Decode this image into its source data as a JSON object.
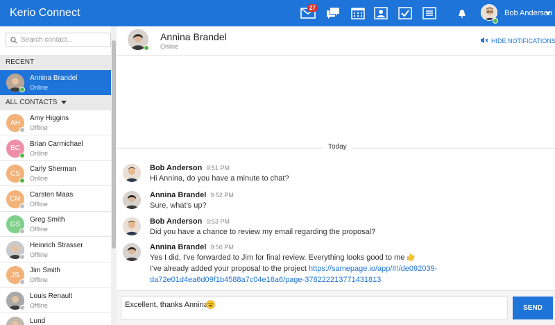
{
  "app": {
    "title": "Kerio Connect"
  },
  "topbar": {
    "mail_badge": "27",
    "user_name": "Bob Anderson",
    "icons": [
      "mail-icon",
      "chat-icon",
      "calendar-icon",
      "contacts-icon",
      "tasks-icon",
      "notes-icon",
      "bell-icon"
    ]
  },
  "sidebar": {
    "search_placeholder": "Search contact...",
    "recent_label": "RECENT",
    "all_contacts_label": "ALL CONTACTS",
    "recent": [
      {
        "name": "Annina Brandel",
        "status": "Online",
        "initials": "",
        "color": "#b8a596",
        "status_color": "#54b94a"
      }
    ],
    "contacts": [
      {
        "name": "Amy Higgins",
        "status": "Offline",
        "initials": "AH",
        "color": "#f3b27a",
        "status_color": "#bdbdbd"
      },
      {
        "name": "Brian Carmichael",
        "status": "Online",
        "initials": "BC",
        "color": "#ee8fa7",
        "status_color": "#54b94a"
      },
      {
        "name": "Carly Sherman",
        "status": "Online",
        "initials": "CS",
        "color": "#f3b27a",
        "status_color": "#54b94a"
      },
      {
        "name": "Carsten Maas",
        "status": "Offline",
        "initials": "CM",
        "color": "#f3b27a",
        "status_color": "#bdbdbd"
      },
      {
        "name": "Greg Smith",
        "status": "Offline",
        "initials": "GS",
        "color": "#7fd08a",
        "status_color": "#bdbdbd"
      },
      {
        "name": "Heinrich Strasser",
        "status": "Offline",
        "initials": "",
        "color": "#c9c9c9",
        "status_color": "#bdbdbd"
      },
      {
        "name": "Jim Smith",
        "status": "Offline",
        "initials": "JS",
        "color": "#f3b27a",
        "status_color": "#bdbdbd"
      },
      {
        "name": "Louis Renault",
        "status": "Offline",
        "initials": "",
        "color": "#a9a9a9",
        "status_color": "#bdbdbd"
      },
      {
        "name": "Lund",
        "status": "",
        "initials": "",
        "color": "#c4b8ad",
        "status_color": "#bdbdbd"
      }
    ]
  },
  "chat": {
    "contact_name": "Annina Brandel",
    "contact_status": "Online",
    "hide_notifications": "HIDE NOTIFICATIONS",
    "day_label": "Today",
    "messages": [
      {
        "author": "Bob Anderson",
        "time": "9:51 PM",
        "lines": [
          "Hi Annina, do you have a minute to chat?"
        ]
      },
      {
        "author": "Annina Brandel",
        "time": "9:52 PM",
        "lines": [
          "Sure, what's up?"
        ]
      },
      {
        "author": "Bob Anderson",
        "time": "9:53 PM",
        "lines": [
          "Did you have a chance to review my email regarding the proposal?"
        ]
      },
      {
        "author": "Annina Brandel",
        "time": "9:56 PM",
        "lines": [
          "Yes I did, I've forwarded to Jim for final review. Everything looks good to me"
        ],
        "line2_prefix": "I've already added your proposal to the project ",
        "link_part1": "https://samepage.io/app/#!/de092039-",
        "link_part2": "da72e01d4ea6d09f1b4588a7c04e16a6/page-378222213771431813"
      }
    ]
  },
  "composer": {
    "value": "Excellent, thanks Annina!",
    "send_label": "SEND"
  },
  "colors": {
    "accent": "#1e74d8",
    "online": "#54b94a",
    "badge": "#d9322c"
  }
}
